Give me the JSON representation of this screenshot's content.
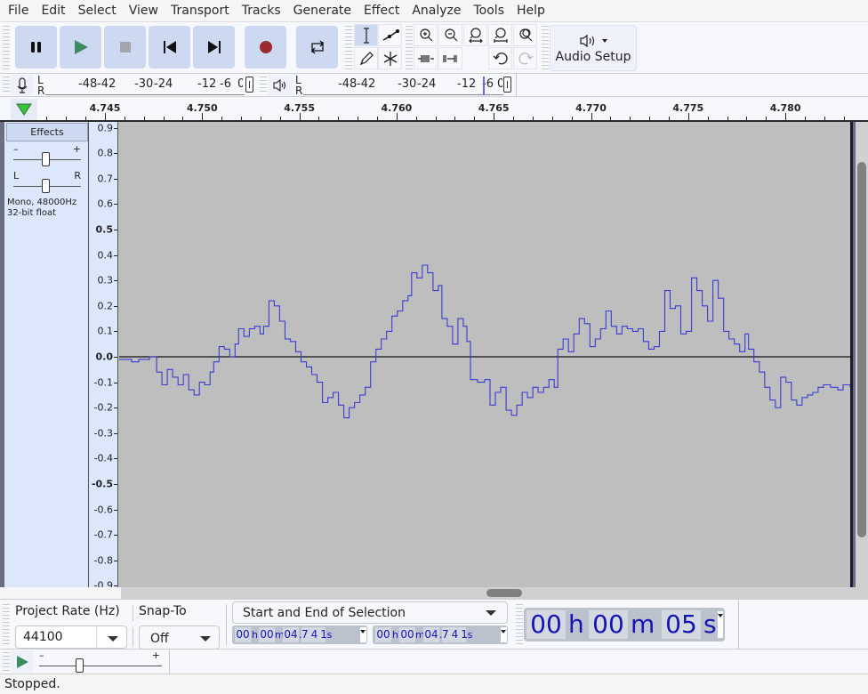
{
  "menu": [
    "File",
    "Edit",
    "Select",
    "View",
    "Transport",
    "Tracks",
    "Generate",
    "Effect",
    "Analyze",
    "Tools",
    "Help"
  ],
  "transport": {
    "pause": "pause-icon",
    "play": "play-icon",
    "stop": "stop-icon",
    "skip_start": "skip-to-start-icon",
    "skip_end": "skip-to-end-icon",
    "record": "record-icon",
    "loop": "loop-icon",
    "colors": {
      "play": "#3e8a62",
      "stop": "#a3a6ad",
      "record": "#9b2b2e",
      "button_bg": "#cdd9f0"
    }
  },
  "audio_setup": {
    "label": "Audio Setup",
    "icon": "speaker-icon"
  },
  "meters": {
    "record_scale": [
      "-48",
      "-42",
      "-30",
      "-24",
      "-12",
      "-6",
      "0"
    ],
    "playback_scale": [
      "-48",
      "-42",
      "-30",
      "-24",
      "-12",
      "-6",
      "0"
    ],
    "channels": [
      "L",
      "R"
    ]
  },
  "timeline": {
    "labels": [
      "4.745",
      "4.750",
      "4.755",
      "4.760",
      "4.765",
      "4.770",
      "4.775",
      "4.780"
    ]
  },
  "track": {
    "effects_label": "Effects",
    "gain_min": "–",
    "gain_max": "+",
    "pan_left": "L",
    "pan_right": "R",
    "info_line1": "Mono, 48000Hz",
    "info_line2": "32-bit float",
    "waveform_color": "#3b3bd0"
  },
  "vruler": [
    {
      "v": "0.9",
      "b": false
    },
    {
      "v": "0.8",
      "b": false
    },
    {
      "v": "0.7",
      "b": false
    },
    {
      "v": "0.6",
      "b": false
    },
    {
      "v": "0.5",
      "b": true
    },
    {
      "v": "0.4",
      "b": false
    },
    {
      "v": "0.3",
      "b": false
    },
    {
      "v": "0.2",
      "b": false
    },
    {
      "v": "0.1",
      "b": false
    },
    {
      "v": "0.0",
      "b": true
    },
    {
      "v": "-0.1",
      "b": false
    },
    {
      "v": "-0.2",
      "b": false
    },
    {
      "v": "-0.3",
      "b": false
    },
    {
      "v": "-0.4",
      "b": false
    },
    {
      "v": "-0.5",
      "b": true
    },
    {
      "v": "-0.6",
      "b": false
    },
    {
      "v": "-0.7",
      "b": false
    },
    {
      "v": "-0.8",
      "b": false
    },
    {
      "v": "-0.9",
      "b": false
    }
  ],
  "waveform": {
    "x_range": [
      4.7425,
      4.7835
    ],
    "samples": [
      [
        4.7425,
        -0.01
      ],
      [
        4.7432,
        -0.02
      ],
      [
        4.7436,
        -0.01
      ],
      [
        4.7442,
        0.0
      ],
      [
        4.7446,
        -0.06
      ],
      [
        4.7449,
        -0.11
      ],
      [
        4.7452,
        -0.05
      ],
      [
        4.7455,
        -0.08
      ],
      [
        4.7458,
        -0.11
      ],
      [
        4.7461,
        -0.07
      ],
      [
        4.7464,
        -0.13
      ],
      [
        4.7467,
        -0.15
      ],
      [
        4.747,
        -0.1
      ],
      [
        4.7473,
        -0.11
      ],
      [
        4.7476,
        -0.06
      ],
      [
        4.7478,
        -0.02
      ],
      [
        4.7481,
        0.04
      ],
      [
        4.7484,
        0.03
      ],
      [
        4.7487,
        0.0
      ],
      [
        4.749,
        0.05
      ],
      [
        4.7492,
        0.11
      ],
      [
        4.7495,
        0.08
      ],
      [
        4.7498,
        0.11
      ],
      [
        4.7501,
        0.12
      ],
      [
        4.7504,
        0.09
      ],
      [
        4.7506,
        0.12
      ],
      [
        4.7509,
        0.22
      ],
      [
        4.7512,
        0.2
      ],
      [
        4.7515,
        0.14
      ],
      [
        4.7518,
        0.07
      ],
      [
        4.7521,
        0.06
      ],
      [
        4.7524,
        0.02
      ],
      [
        4.7527,
        -0.02
      ],
      [
        4.753,
        -0.04
      ],
      [
        4.7533,
        -0.07
      ],
      [
        4.7536,
        -0.1
      ],
      [
        4.7539,
        -0.18
      ],
      [
        4.7542,
        -0.16
      ],
      [
        4.7545,
        -0.14
      ],
      [
        4.7548,
        -0.19
      ],
      [
        4.7551,
        -0.24
      ],
      [
        4.7554,
        -0.2
      ],
      [
        4.7557,
        -0.18
      ],
      [
        4.756,
        -0.15
      ],
      [
        4.7563,
        -0.12
      ],
      [
        4.7566,
        -0.02
      ],
      [
        4.7569,
        0.03
      ],
      [
        4.7572,
        0.07
      ],
      [
        4.7575,
        0.1
      ],
      [
        4.7578,
        0.16
      ],
      [
        4.7581,
        0.18
      ],
      [
        4.7584,
        0.22
      ],
      [
        4.7587,
        0.24
      ],
      [
        4.7589,
        0.33
      ],
      [
        4.7592,
        0.31
      ],
      [
        4.7595,
        0.36
      ],
      [
        4.7598,
        0.33
      ],
      [
        4.7601,
        0.26
      ],
      [
        4.7604,
        0.28
      ],
      [
        4.7606,
        0.15
      ],
      [
        4.7609,
        0.12
      ],
      [
        4.7612,
        0.05
      ],
      [
        4.7615,
        0.15
      ],
      [
        4.7618,
        0.12
      ],
      [
        4.762,
        0.06
      ],
      [
        4.7622,
        -0.09
      ],
      [
        4.7626,
        -0.1
      ],
      [
        4.763,
        -0.09
      ],
      [
        4.7633,
        -0.19
      ],
      [
        4.7636,
        -0.14
      ],
      [
        4.7639,
        -0.12
      ],
      [
        4.7642,
        -0.21
      ],
      [
        4.7645,
        -0.23
      ],
      [
        4.7648,
        -0.19
      ],
      [
        4.7651,
        -0.14
      ],
      [
        4.7654,
        -0.16
      ],
      [
        4.7657,
        -0.12
      ],
      [
        4.766,
        -0.14
      ],
      [
        4.7663,
        -0.12
      ],
      [
        4.7666,
        -0.09
      ],
      [
        4.7669,
        -0.12
      ],
      [
        4.7671,
        0.03
      ],
      [
        4.7674,
        0.07
      ],
      [
        4.7677,
        0.02
      ],
      [
        4.768,
        0.09
      ],
      [
        4.7683,
        0.15
      ],
      [
        4.7686,
        0.13
      ],
      [
        4.7689,
        0.04
      ],
      [
        4.7692,
        0.07
      ],
      [
        4.7695,
        0.11
      ],
      [
        4.7698,
        0.18
      ],
      [
        4.7701,
        0.12
      ],
      [
        4.7704,
        0.09
      ],
      [
        4.7707,
        0.12
      ],
      [
        4.771,
        0.11
      ],
      [
        4.7713,
        0.1
      ],
      [
        4.7716,
        0.11
      ],
      [
        4.7719,
        0.06
      ],
      [
        4.7722,
        0.03
      ],
      [
        4.7725,
        0.04
      ],
      [
        4.7728,
        0.1
      ],
      [
        4.7731,
        0.26
      ],
      [
        4.7734,
        0.19
      ],
      [
        4.7737,
        0.2
      ],
      [
        4.774,
        0.09
      ],
      [
        4.7743,
        0.1
      ],
      [
        4.7746,
        0.31
      ],
      [
        4.7749,
        0.26
      ],
      [
        4.7752,
        0.2
      ],
      [
        4.7755,
        0.14
      ],
      [
        4.7758,
        0.3
      ],
      [
        4.7761,
        0.23
      ],
      [
        4.7764,
        0.1
      ],
      [
        4.7767,
        0.07
      ],
      [
        4.777,
        0.05
      ],
      [
        4.7773,
        0.02
      ],
      [
        4.7776,
        0.09
      ],
      [
        4.7778,
        0.03
      ],
      [
        4.7781,
        -0.02
      ],
      [
        4.7784,
        -0.06
      ],
      [
        4.7787,
        -0.12
      ],
      [
        4.779,
        -0.17
      ],
      [
        4.7793,
        -0.2
      ],
      [
        4.7796,
        -0.08
      ],
      [
        4.7799,
        -0.1
      ],
      [
        4.7802,
        -0.17
      ],
      [
        4.7805,
        -0.19
      ],
      [
        4.7808,
        -0.16
      ],
      [
        4.7811,
        -0.15
      ],
      [
        4.7814,
        -0.14
      ],
      [
        4.7817,
        -0.12
      ],
      [
        4.782,
        -0.11
      ],
      [
        4.7824,
        -0.12
      ],
      [
        4.7828,
        -0.13
      ],
      [
        4.7831,
        -0.11
      ],
      [
        4.7835,
        -0.12
      ]
    ]
  },
  "selection": {
    "project_rate_label": "Project Rate (Hz)",
    "project_rate_value": "44100",
    "snap_label": "Snap-To",
    "snap_value": "Off",
    "mode_value": "Start and End of Selection",
    "start_time": {
      "hh": "00",
      "mm": "00",
      "ss": "04",
      "ms": "741"
    },
    "end_time": {
      "hh": "00",
      "mm": "00",
      "ss": "04",
      "ms": "741"
    },
    "audio_position": {
      "hh": "00",
      "mm": "00",
      "ss": "05"
    },
    "units": {
      "h": "h",
      "m": "m",
      "s": "s"
    }
  },
  "play_at_speed": {
    "min": "–",
    "max": "+",
    "speed": 1.0
  },
  "status": "Stopped."
}
